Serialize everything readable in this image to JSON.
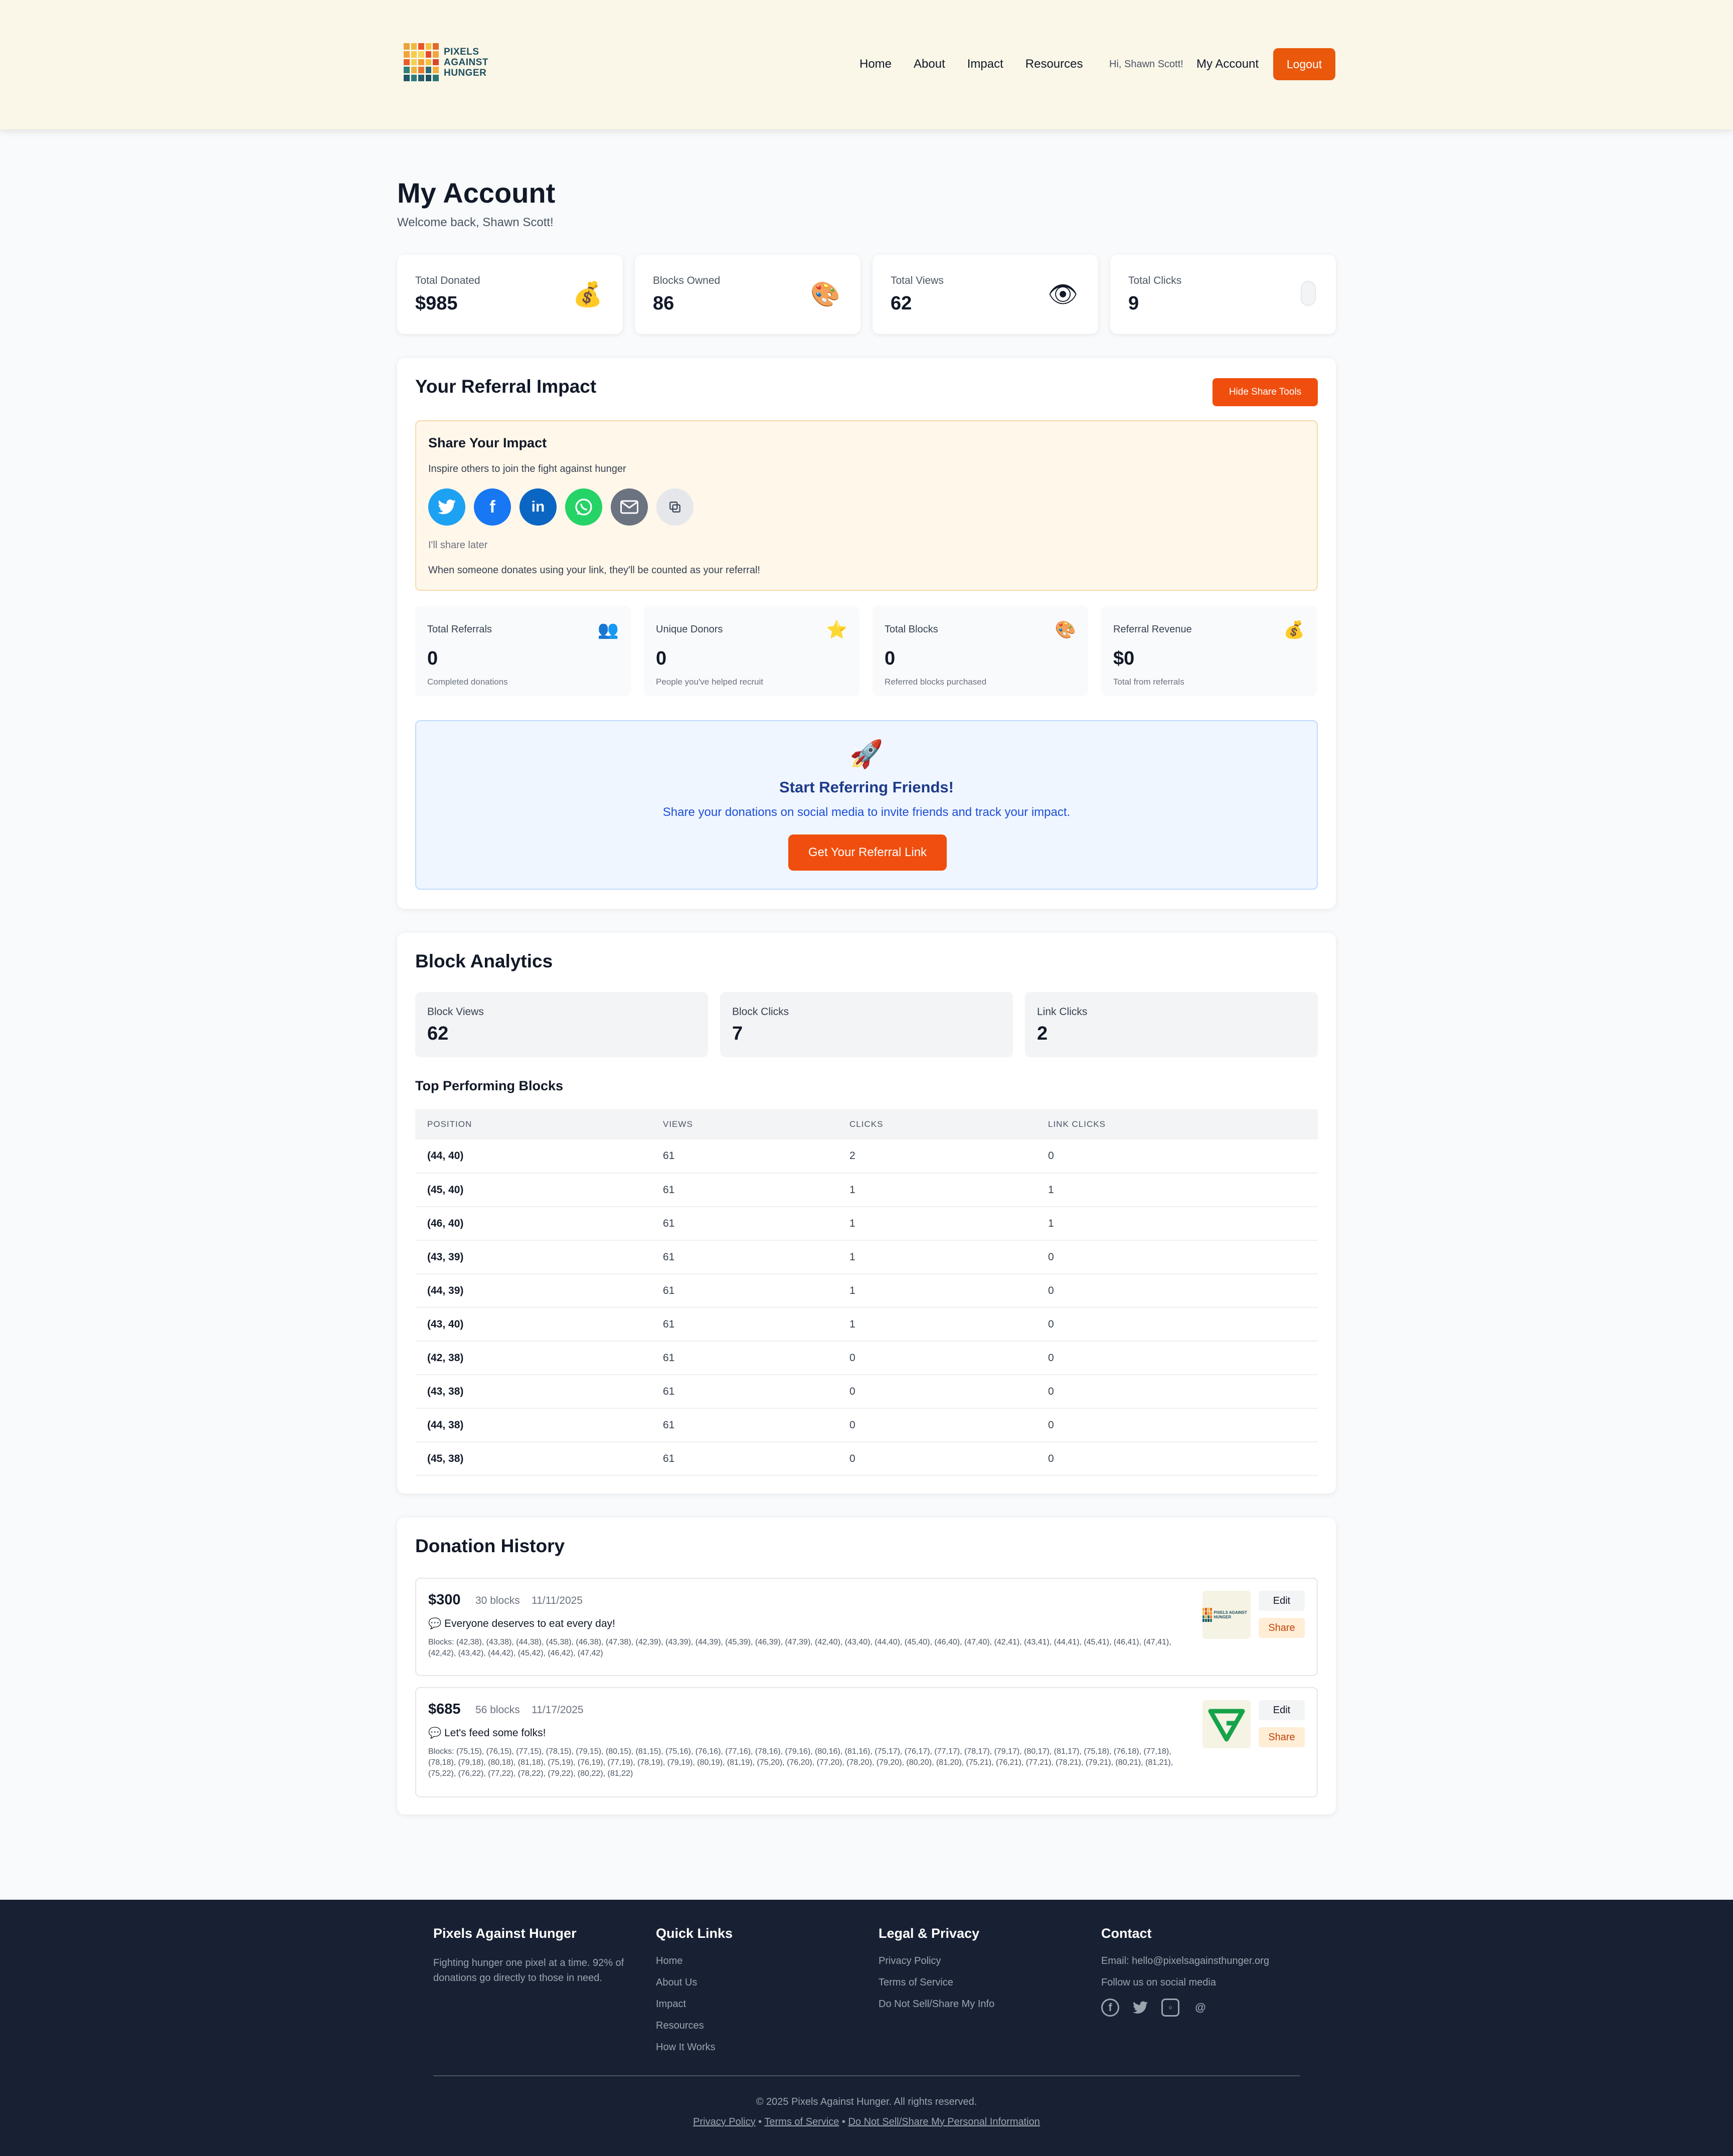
{
  "header": {
    "logo_text": "PIXELS\nAGAINST\nHUNGER",
    "nav": [
      "Home",
      "About",
      "Impact",
      "Resources"
    ],
    "greeting": "Hi, Shawn Scott!",
    "my_account": "My Account",
    "logout": "Logout"
  },
  "page": {
    "title": "My Account",
    "welcome": "Welcome back, Shawn Scott!"
  },
  "stats": [
    {
      "label": "Total Donated",
      "value": "$985",
      "icon": "money-bag-icon"
    },
    {
      "label": "Blocks Owned",
      "value": "86",
      "icon": "palette-icon"
    },
    {
      "label": "Total Views",
      "value": "62",
      "icon": "eye-icon"
    },
    {
      "label": "Total Clicks",
      "value": "9",
      "icon": "mouse-icon"
    }
  ],
  "referral": {
    "title": "Your Referral Impact",
    "hide_button": "Hide Share Tools",
    "share_title": "Share Your Impact",
    "share_sub": "Inspire others to join the fight against hunger",
    "share_later": "I'll share later",
    "share_note": "When someone donates using your link, they'll be counted as your referral!",
    "cards": [
      {
        "label": "Total Referrals",
        "value": "0",
        "caption": "Completed donations",
        "icon": "people-icon"
      },
      {
        "label": "Unique Donors",
        "value": "0",
        "caption": "People you've helped recruit",
        "icon": "star-icon"
      },
      {
        "label": "Total Blocks",
        "value": "0",
        "caption": "Referred blocks purchased",
        "icon": "palette-icon"
      },
      {
        "label": "Referral Revenue",
        "value": "$0",
        "caption": "Total from referrals",
        "icon": "money-bag-icon"
      }
    ],
    "start_title": "Start Referring Friends!",
    "start_sub": "Share your donations on social media to invite friends and track your impact.",
    "start_button": "Get Your Referral Link"
  },
  "analytics": {
    "title": "Block Analytics",
    "cards": [
      {
        "label": "Block Views",
        "value": "62"
      },
      {
        "label": "Block Clicks",
        "value": "7"
      },
      {
        "label": "Link Clicks",
        "value": "2"
      }
    ],
    "top_title": "Top Performing Blocks",
    "columns": [
      "POSITION",
      "VIEWS",
      "CLICKS",
      "LINK CLICKS"
    ],
    "rows": [
      [
        "(44, 40)",
        "61",
        "2",
        "0"
      ],
      [
        "(45, 40)",
        "61",
        "1",
        "1"
      ],
      [
        "(46, 40)",
        "61",
        "1",
        "1"
      ],
      [
        "(43, 39)",
        "61",
        "1",
        "0"
      ],
      [
        "(44, 39)",
        "61",
        "1",
        "0"
      ],
      [
        "(43, 40)",
        "61",
        "1",
        "0"
      ],
      [
        "(42, 38)",
        "61",
        "0",
        "0"
      ],
      [
        "(43, 38)",
        "61",
        "0",
        "0"
      ],
      [
        "(44, 38)",
        "61",
        "0",
        "0"
      ],
      [
        "(45, 38)",
        "61",
        "0",
        "0"
      ]
    ]
  },
  "donations": {
    "title": "Donation History",
    "edit_label": "Edit",
    "share_label": "Share",
    "items": [
      {
        "amount": "$300",
        "blocks_count": "30 blocks",
        "date": "11/11/2025",
        "message": "💬 Everyone deserves to eat every day!",
        "blocks": "Blocks: (42,38), (43,38), (44,38), (45,38), (46,38), (47,38), (42,39), (43,39), (44,39), (45,39), (46,39), (47,39), (42,40), (43,40), (44,40), (45,40), (46,40), (47,40), (42,41), (43,41), (44,41), (45,41), (46,41), (47,41), (42,42), (43,42), (44,42), (45,42), (46,42), (47,42)"
      },
      {
        "amount": "$685",
        "blocks_count": "56 blocks",
        "date": "11/17/2025",
        "message": "💬 Let's feed some folks!",
        "blocks": "Blocks: (75,15), (76,15), (77,15), (78,15), (79,15), (80,15), (81,15), (75,16), (76,16), (77,16), (78,16), (79,16), (80,16), (81,16), (75,17), (76,17), (77,17), (78,17), (79,17), (80,17), (81,17), (75,18), (76,18), (77,18), (78,18), (79,18), (80,18), (81,18), (75,19), (76,19), (77,19), (78,19), (79,19), (80,19), (81,19), (75,20), (76,20), (77,20), (78,20), (79,20), (80,20), (81,20), (75,21), (76,21), (77,21), (78,21), (79,21), (80,21), (81,21), (75,22), (76,22), (77,22), (78,22), (79,22), (80,22), (81,22)"
      }
    ]
  },
  "footer": {
    "about_title": "Pixels Against Hunger",
    "about_text": "Fighting hunger one pixel at a time. 92% of donations go directly to those in need.",
    "quick_title": "Quick Links",
    "quick_links": [
      "Home",
      "About Us",
      "Impact",
      "Resources",
      "How It Works"
    ],
    "legal_title": "Legal & Privacy",
    "legal_links": [
      "Privacy Policy",
      "Terms of Service",
      "Do Not Sell/Share My Info"
    ],
    "contact_title": "Contact",
    "email": "Email: hello@pixelsagainsthunger.org",
    "follow": "Follow us on social media",
    "copyright": "© 2025 Pixels Against Hunger. All rights reserved.",
    "bottom_links": [
      "Privacy Policy",
      "Terms of Service",
      "Do Not Sell/Share My Personal Information"
    ],
    "separator": " • "
  },
  "colors": {
    "accent": "#f04e0e",
    "header_bg": "#faf7e8",
    "footer_bg": "#182033"
  }
}
